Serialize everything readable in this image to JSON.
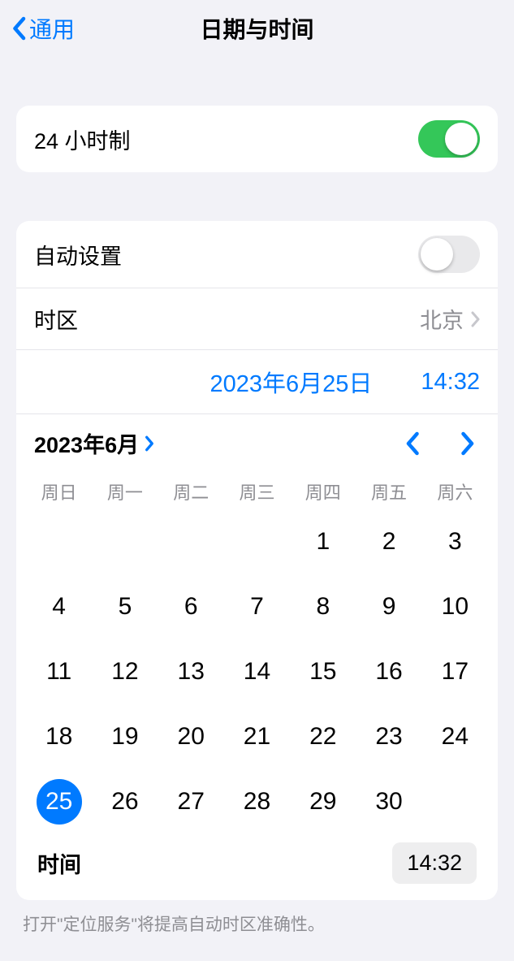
{
  "header": {
    "back": "通用",
    "title": "日期与时间"
  },
  "rows": {
    "hour24": "24 小时制",
    "auto": "自动设置",
    "tz_label": "时区",
    "tz_value": "北京"
  },
  "selected": {
    "date": "2023年6月25日",
    "time": "14:32"
  },
  "calendar": {
    "month_label": "2023年6月",
    "dow": [
      "周日",
      "周一",
      "周二",
      "周三",
      "周四",
      "周五",
      "周六"
    ],
    "first_weekday": 4,
    "days_in_month": 30,
    "selected_day": 25
  },
  "time": {
    "label": "时间",
    "value": "14:32"
  },
  "footer": "打开\"定位服务\"将提高自动时区准确性。"
}
